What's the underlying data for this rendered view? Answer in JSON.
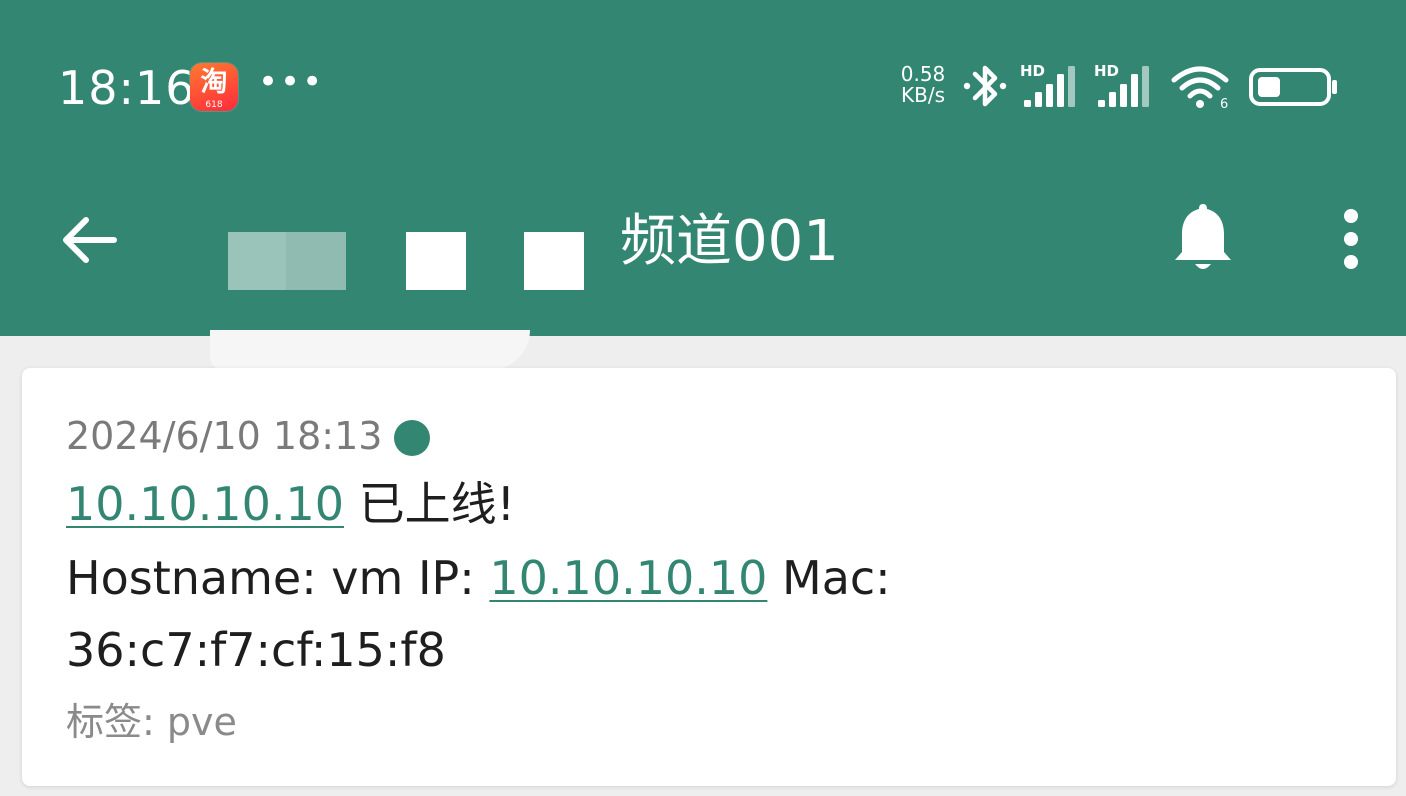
{
  "status_bar": {
    "time": "18:16",
    "app_badge_text": "淘",
    "app_badge_sub": "618",
    "more_dots": "•••",
    "net_speed_value": "0.58",
    "net_speed_unit": "KB/s",
    "signal_label": "HD",
    "wifi_label": "6",
    "icons": [
      "taobao-app-icon",
      "bluetooth-icon",
      "signal-icon",
      "signal-icon",
      "wifi-icon",
      "battery-icon"
    ]
  },
  "app_bar": {
    "title_visible": "频道001",
    "title_fragment": "€",
    "back_icon": "arrow-left",
    "bell_icon": "bell",
    "menu_icon": "more-vert"
  },
  "message": {
    "timestamp": "2024/6/10 18:13",
    "line1": {
      "ip_link": "10.10.10.10",
      "status": " 已上线!"
    },
    "line2": {
      "prefix": "Hostname: vm IP: ",
      "ip_link": "10.10.10.10",
      "suffix": " Mac:"
    },
    "line3": "36:c7:f7:cf:15:f8",
    "tags": "标签: pve"
  },
  "colors": {
    "primary": "#338672",
    "background": "#eeeeee",
    "card": "#ffffff",
    "text": "#1e1e1e",
    "muted": "#7a7a7a"
  }
}
